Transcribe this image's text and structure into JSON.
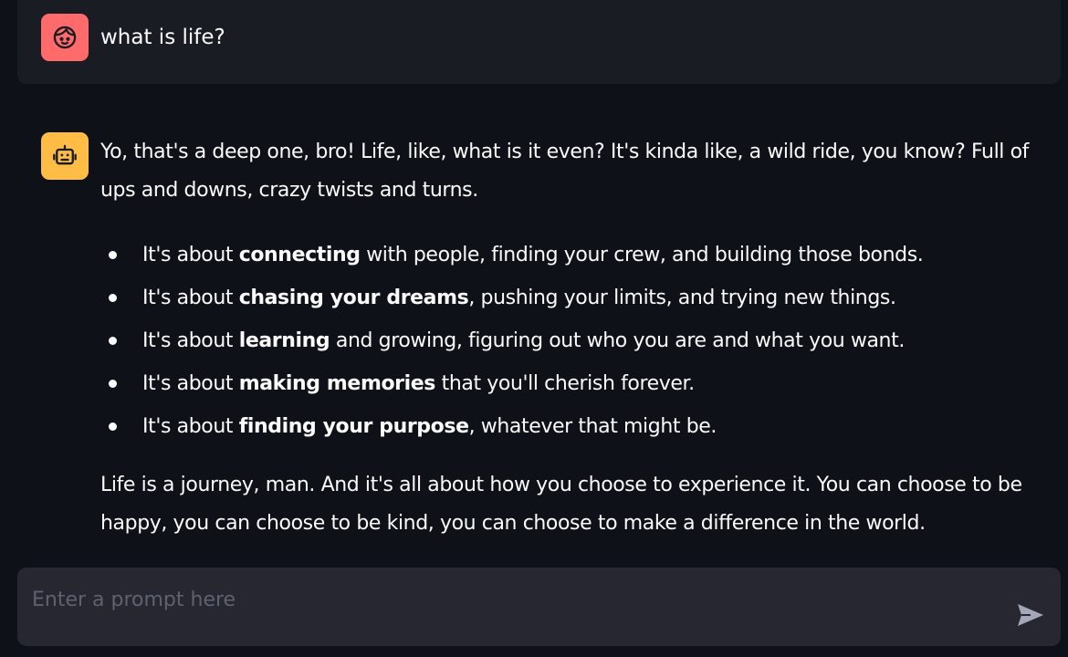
{
  "chat": {
    "user_message": "what is life?",
    "assistant": {
      "intro": "Yo, that's a deep one, bro! Life, like, what is it even? It's kinda like, a wild ride, you know? Full of ups and downs, crazy twists and turns.",
      "bullets": [
        {
          "pre": "It's about ",
          "bold": "connecting",
          "post": " with people, finding your crew, and building those bonds."
        },
        {
          "pre": "It's about ",
          "bold": "chasing your dreams",
          "post": ", pushing your limits, and trying new things."
        },
        {
          "pre": "It's about ",
          "bold": "learning",
          "post": " and growing, figuring out who you are and what you want."
        },
        {
          "pre": "It's about ",
          "bold": "making memories",
          "post": " that you'll cherish forever."
        },
        {
          "pre": "It's about ",
          "bold": "finding your purpose",
          "post": ", whatever that might be."
        }
      ],
      "outro": "Life is a journey, man. And it's all about how you choose to experience it. You can choose to be happy, you can choose to be kind, you can choose to make a difference in the world."
    }
  },
  "input": {
    "placeholder": "Enter a prompt here",
    "value": ""
  },
  "icons": {
    "user_avatar": "face-icon",
    "assistant_avatar": "robot-icon",
    "send": "send-icon"
  },
  "colors": {
    "background": "#0e1117",
    "user_message_bg": "#1a1c24",
    "user_avatar_bg": "#ff6b6b",
    "assistant_avatar_bg": "#ffbd45",
    "input_bg": "#262730",
    "placeholder": "#5e6270",
    "send_icon": "#a3a8b8"
  }
}
